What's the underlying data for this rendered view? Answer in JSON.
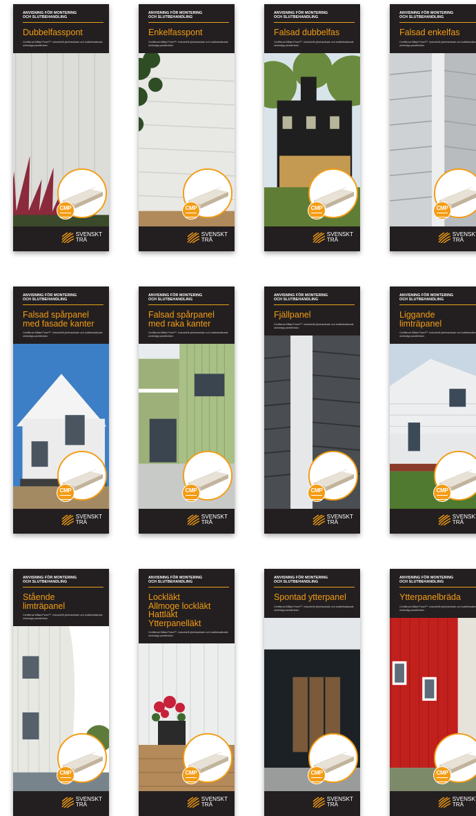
{
  "brochure_common": {
    "kicker_line1": "ANVISNING FÖR MONTERING",
    "kicker_line2": "OCH SLUTBEHANDLING",
    "description": "Certifierad Målad Panel™. Industriellt ytbehandlade och kvalitetssäkrade utvändiga panelbrädor.",
    "badge": "CMP",
    "brand_line1": "SVENSKT",
    "brand_line2": "TRÄ"
  },
  "brochures": [
    {
      "title": "Dubbelfasspont",
      "scene": "white-panel-plant"
    },
    {
      "title": "Enkelfasspont",
      "scene": "white-panel-vine"
    },
    {
      "title": "Falsad dubbelfas",
      "scene": "black-house-trees"
    },
    {
      "title": "Falsad enkelfas",
      "scene": "grey-corner"
    },
    {
      "title": "Falsad spårpanel\nmed fasade kanter",
      "scene": "white-villa"
    },
    {
      "title": "Falsad spårpanel\nmed raka kanter",
      "scene": "green-apartment"
    },
    {
      "title": "Fjällpanel",
      "scene": "grey-clapboard"
    },
    {
      "title": "Liggande\nlimträpanel",
      "scene": "white-house-lawn"
    },
    {
      "title": "Stående\nlimträpanel",
      "scene": "round-white-house"
    },
    {
      "title": "Lockläkt\nAllmoge lockläkt\nHattläkt\nYtterpanelläkt",
      "scene": "planter-flowers"
    },
    {
      "title": "Spontad ytterpanel",
      "scene": "black-cabin"
    },
    {
      "title": "Ytterpanelbräda",
      "scene": "red-house"
    }
  ],
  "colors": {
    "dark": "#231f20",
    "accent": "#f39c14"
  }
}
